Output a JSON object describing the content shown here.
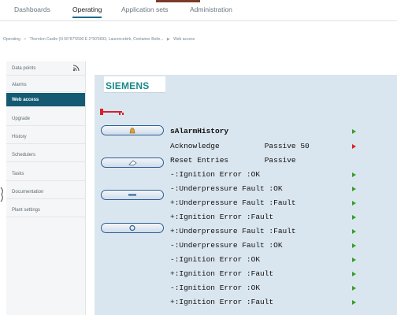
{
  "topnav": {
    "tabs": [
      {
        "label": "Dashboards",
        "active": false
      },
      {
        "label": "Operating",
        "active": true
      },
      {
        "label": "Application sets",
        "active": false
      },
      {
        "label": "Administration",
        "active": false
      }
    ]
  },
  "breadcrumb": {
    "root": "Operating",
    "separator1": ">",
    "site": "Thornton Castle (N 56°87'6590 E 2°50'6693, Laurencekirk, Container Boile...",
    "separator2": "▶",
    "page": "Web access"
  },
  "sidebar": {
    "items": [
      {
        "label": "Data points",
        "active": false,
        "icon": "rss-icon"
      },
      {
        "label": "Alarms",
        "active": false
      },
      {
        "label": "Web access",
        "active": true
      },
      {
        "label": "Upgrade",
        "active": false
      },
      {
        "label": "History",
        "active": false
      },
      {
        "label": "Schedulers",
        "active": false
      },
      {
        "label": "Tasks",
        "active": false
      },
      {
        "label": "Documentation",
        "active": false
      },
      {
        "label": "Plant settings",
        "active": false
      }
    ]
  },
  "panel": {
    "brand": "SIEMENS",
    "buttons": [
      {
        "icon": "bell-icon"
      },
      {
        "icon": "eraser-icon"
      },
      {
        "icon": "minus-icon"
      },
      {
        "icon": "refresh-icon"
      }
    ],
    "rows": [
      {
        "text": "sAlarmHistory",
        "bold": true,
        "arrow": "green"
      },
      {
        "text": "Acknowledge          Passive 50",
        "bold": false,
        "arrow": "red"
      },
      {
        "text": "Reset Entries        Passive",
        "bold": false,
        "arrow": ""
      },
      {
        "text": "-:Ignition Error :OK",
        "bold": false,
        "arrow": "green"
      },
      {
        "text": "-:Underpressure Fault :OK",
        "bold": false,
        "arrow": "green"
      },
      {
        "text": "+:Underpressure Fault :Fault",
        "bold": false,
        "arrow": "green"
      },
      {
        "text": "+:Ignition Error :Fault",
        "bold": false,
        "arrow": "green"
      },
      {
        "text": "+:Underpressure Fault :Fault",
        "bold": false,
        "arrow": "green"
      },
      {
        "text": "-:Underpressure Fault :OK",
        "bold": false,
        "arrow": "green"
      },
      {
        "text": "-:Ignition Error :OK",
        "bold": false,
        "arrow": "green"
      },
      {
        "text": "+:Ignition Error :Fault",
        "bold": false,
        "arrow": "green"
      },
      {
        "text": "-:Ignition Error :OK",
        "bold": false,
        "arrow": "green"
      },
      {
        "text": "+:Ignition Error :Fault",
        "bold": false,
        "arrow": "green"
      }
    ]
  },
  "colors": {
    "accent": "#155a73",
    "panel_bg": "#dae6ef",
    "brand": "#1a8a8a",
    "arrow_green": "#3a9c2a",
    "arrow_red": "#d8202a"
  }
}
